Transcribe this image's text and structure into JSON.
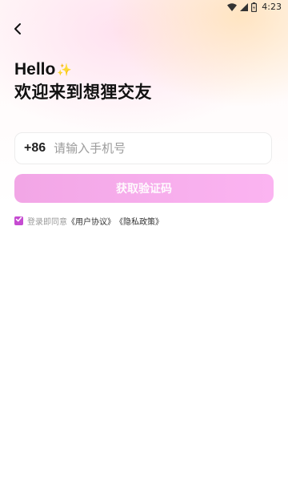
{
  "status_bar": {
    "time": "4:23",
    "icons": [
      "wifi-icon",
      "signal-icon",
      "battery-icon"
    ]
  },
  "header": {
    "back_icon": "chevron-left-icon"
  },
  "greeting": {
    "hello": "Hello",
    "sparkle": "✨",
    "subtitle": "欢迎来到想狸交友"
  },
  "phone_form": {
    "country_code": "+86",
    "phone_placeholder": "请输入手机号",
    "phone_value": ""
  },
  "get_code_button": {
    "label": "获取验证码"
  },
  "agreement": {
    "checked": true,
    "prefix": "登录即同意",
    "user_agreement": "《用户协议》",
    "privacy_policy": "《隐私政策》"
  },
  "colors": {
    "accent": "#c54bd1",
    "button_start": "#f2a6e6",
    "button_end": "#fbb4f1"
  }
}
